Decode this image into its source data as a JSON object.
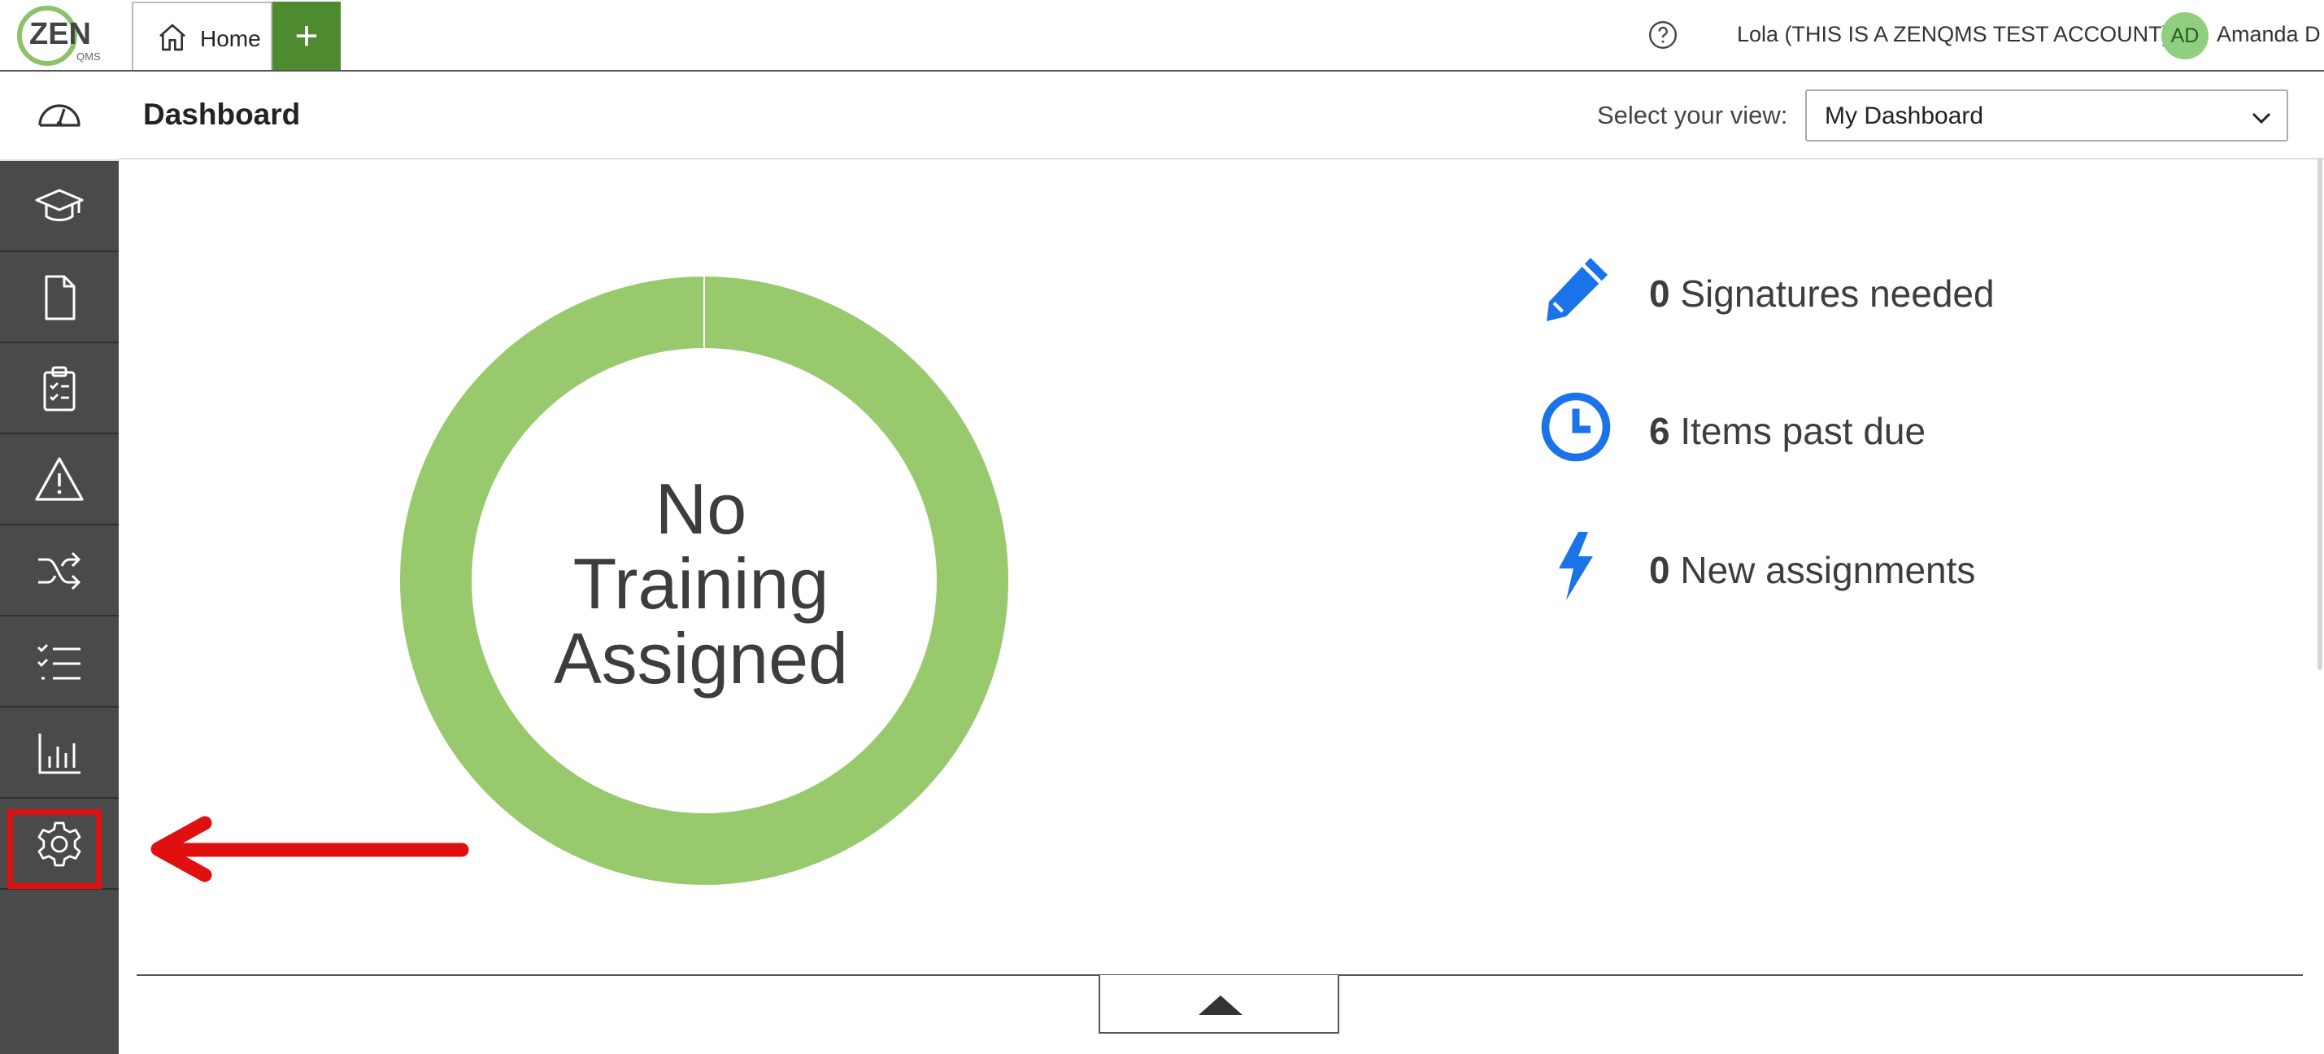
{
  "topbar": {
    "logo_text": "ZEN",
    "logo_subtext": "QMS",
    "home_tab_label": "Home",
    "add_tab_symbol": "+",
    "account_name": "Lola (THIS IS A ZENQMS TEST ACCOUNT)",
    "avatar_initials": "AD",
    "user_name": "Amanda D"
  },
  "sidebar": {
    "items": [
      {
        "name": "dashboard",
        "icon": "speedometer-icon"
      },
      {
        "name": "training",
        "icon": "graduation-cap-icon"
      },
      {
        "name": "documents",
        "icon": "document-icon"
      },
      {
        "name": "checklists",
        "icon": "clipboard-check-icon"
      },
      {
        "name": "issues",
        "icon": "warning-icon"
      },
      {
        "name": "change-control",
        "icon": "shuffle-icon"
      },
      {
        "name": "tasks",
        "icon": "checklist-icon"
      },
      {
        "name": "reports",
        "icon": "bar-chart-icon"
      },
      {
        "name": "settings",
        "icon": "gear-icon"
      }
    ]
  },
  "header": {
    "title": "Dashboard",
    "view_label": "Select your view:",
    "view_selected": "My Dashboard"
  },
  "training": {
    "line1": "No",
    "line2": "Training",
    "line3": "Assigned"
  },
  "stats": [
    {
      "count": "0",
      "label": "Signatures needed",
      "icon": "pencil-icon"
    },
    {
      "count": "6",
      "label": "Items past due",
      "icon": "clock-icon"
    },
    {
      "count": "0",
      "label": "New assignments",
      "icon": "lightning-icon"
    }
  ],
  "colors": {
    "accent_green": "#4e8a30",
    "donut_green": "#98ca6d",
    "icon_blue": "#1a73e8",
    "sidebar_bg": "#4a4a4a",
    "annotation_red": "#e01010"
  }
}
